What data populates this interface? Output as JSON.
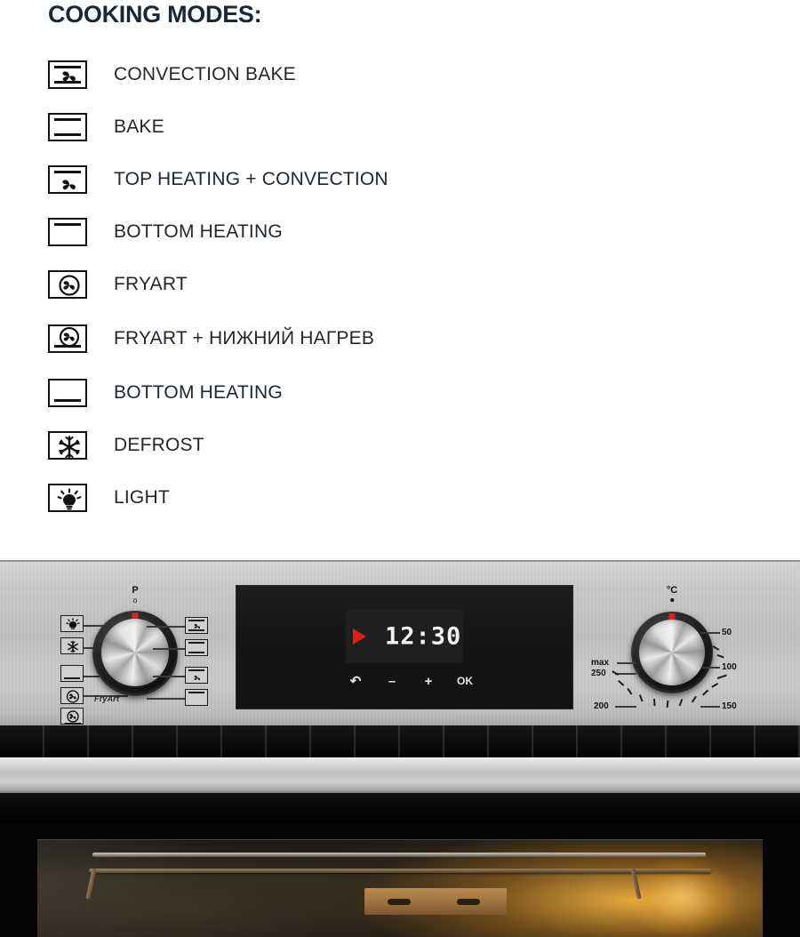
{
  "header": {
    "title": "COOKING MODES:"
  },
  "modes": [
    {
      "label": "CONVECTION BAKE",
      "icon": "convection-bake-icon"
    },
    {
      "label": "BAKE",
      "icon": "bake-icon"
    },
    {
      "label": "TOP HEATING + CONVECTION",
      "icon": "top-heating-convection-icon"
    },
    {
      "label": "BOTTOM HEATING",
      "icon": "bottom-heating-icon"
    },
    {
      "label": "FRYART",
      "icon": "fryart-icon"
    },
    {
      "label": "FRYART + НИЖНИЙ НАГРЕВ",
      "icon": "fryart-bottom-heating-icon"
    },
    {
      "label": "BOTTOM HEATING",
      "icon": "bottom-heating-icon"
    },
    {
      "label": "DEFROST",
      "icon": "defrost-snowflake-icon"
    },
    {
      "label": "LIGHT",
      "icon": "light-bulb-icon"
    }
  ],
  "oven": {
    "function_knob": {
      "name": "function-selector-knob",
      "top_label": "P",
      "off_label": "o",
      "brand_script": "FryArt",
      "left_icons": [
        "light-bulb-icon",
        "defrost-snowflake-icon",
        "bottom-heating-icon",
        "fryart-icon",
        "fryart-bottom-heating-icon"
      ],
      "right_icons": [
        "convection-bake-icon",
        "bake-icon",
        "top-heating-convection-icon",
        "bottom-heating-icon"
      ]
    },
    "display": {
      "name": "oven-display",
      "time": "12:30",
      "indicator": "play-triangle-icon",
      "buttons": [
        {
          "name": "back-button",
          "glyph": "↶"
        },
        {
          "name": "minus-button",
          "glyph": "–"
        },
        {
          "name": "plus-button",
          "glyph": "+"
        },
        {
          "name": "ok-button",
          "glyph": "OK"
        }
      ]
    },
    "temperature_knob": {
      "name": "temperature-knob",
      "unit": "°C",
      "ticks": [
        "50",
        "100",
        "150",
        "200",
        "250",
        "max"
      ]
    }
  },
  "colors": {
    "title": "#1b2733",
    "label": "#20272e",
    "icon_stroke": "#121212",
    "indicator_red": "#e01b1b",
    "knob_mark_red": "#d8202a",
    "lcd_text": "#f2f2f2",
    "panel_steel": "#c4c4c4",
    "cavity_glow": "#ffba42"
  }
}
